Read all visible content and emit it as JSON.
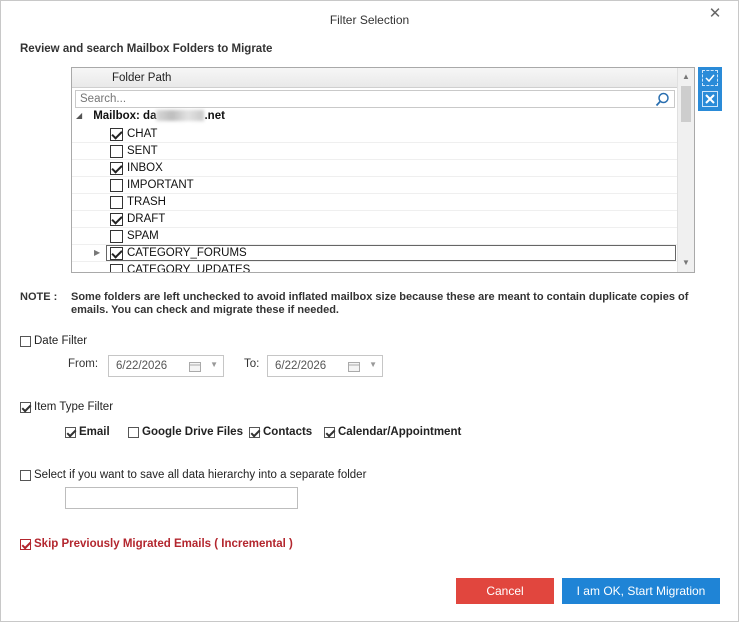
{
  "dialog": {
    "title": "Filter Selection",
    "close_symbol": "✕",
    "section_label": "Review and search Mailbox Folders to Migrate"
  },
  "tree": {
    "header": "Folder Path",
    "search_placeholder": "Search...",
    "mailbox_prefix": "Mailbox: da",
    "mailbox_suffix": ".net",
    "folders": [
      {
        "label": "CHAT",
        "checked": true
      },
      {
        "label": "SENT",
        "checked": false
      },
      {
        "label": "INBOX",
        "checked": true
      },
      {
        "label": "IMPORTANT",
        "checked": false
      },
      {
        "label": "TRASH",
        "checked": false
      },
      {
        "label": "DRAFT",
        "checked": true
      },
      {
        "label": "SPAM",
        "checked": false
      },
      {
        "label": "CATEGORY_FORUMS",
        "checked": true,
        "selected": true,
        "expandable": true
      },
      {
        "label": "CATEGORY_UPDATES",
        "checked": false
      }
    ]
  },
  "note": {
    "label": "NOTE :",
    "text": "Some folders are left unchecked to avoid inflated mailbox size because these are meant to contain duplicate copies of emails. You can check and migrate these if needed."
  },
  "date_filter": {
    "label": "Date Filter",
    "checked": false,
    "from_label": "From:",
    "from_value": "6/22/2026",
    "to_label": "To:",
    "to_value": "6/22/2026"
  },
  "item_type_filter": {
    "label": "Item Type Filter",
    "checked": true,
    "options": [
      {
        "label": "Email",
        "checked": true
      },
      {
        "label": "Google Drive Files",
        "checked": false
      },
      {
        "label": "Contacts",
        "checked": true
      },
      {
        "label": "Calendar/Appointment",
        "checked": true
      }
    ]
  },
  "hierarchy": {
    "label": "Select if you want to save all data hierarchy into a separate folder",
    "checked": false,
    "folder_value": ""
  },
  "skip": {
    "label": "Skip Previously Migrated Emails ( Incremental )",
    "checked": true,
    "color": "#b3262e"
  },
  "buttons": {
    "cancel": "Cancel",
    "ok": "I am OK, Start Migration",
    "cancel_color": "#e1463e",
    "ok_color": "#1f84d6"
  }
}
